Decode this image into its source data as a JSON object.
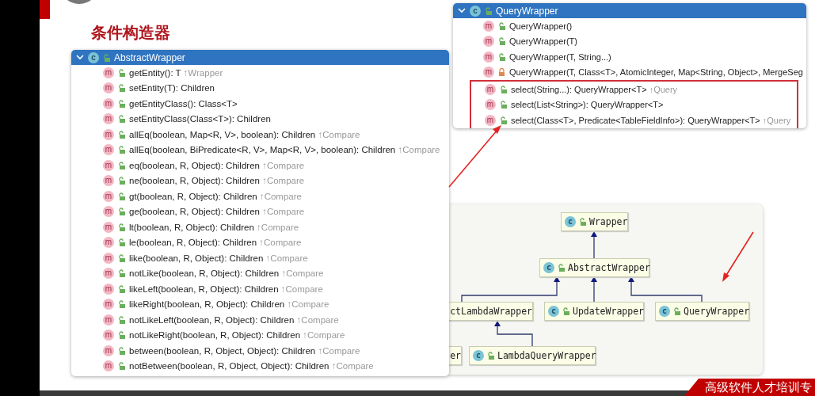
{
  "slide": {
    "title": "条件构造器",
    "footer": "高级软件人才培训专"
  },
  "popups": [
    {
      "header": {
        "label": "AbstractWrapper",
        "badge": "c",
        "expanded": true
      },
      "members": [
        {
          "badge": "m",
          "locked": false,
          "signature": "getEntity(): T",
          "origin": "↑Wrapper",
          "highlighted": false
        },
        {
          "badge": "m",
          "locked": false,
          "signature": "setEntity(T): Children",
          "highlighted": false
        },
        {
          "badge": "m",
          "locked": false,
          "signature": "getEntityClass(): Class<T>",
          "highlighted": false
        },
        {
          "badge": "m",
          "locked": false,
          "signature": "setEntityClass(Class<T>): Children",
          "highlighted": false
        },
        {
          "badge": "m",
          "locked": false,
          "signature": "allEq(boolean, Map<R, V>, boolean): Children",
          "origin": "↑Compare",
          "highlighted": false
        },
        {
          "badge": "m",
          "locked": false,
          "signature": "allEq(boolean, BiPredicate<R, V>, Map<R, V>, boolean): Children",
          "origin": "↑Compare",
          "highlighted": false
        },
        {
          "badge": "m",
          "locked": false,
          "signature": "eq(boolean, R, Object): Children",
          "origin": "↑Compare",
          "highlighted": false
        },
        {
          "badge": "m",
          "locked": false,
          "signature": "ne(boolean, R, Object): Children",
          "origin": "↑Compare",
          "highlighted": false
        },
        {
          "badge": "m",
          "locked": false,
          "signature": "gt(boolean, R, Object): Children",
          "origin": "↑Compare",
          "highlighted": false
        },
        {
          "badge": "m",
          "locked": false,
          "signature": "ge(boolean, R, Object): Children",
          "origin": "↑Compare",
          "highlighted": false
        },
        {
          "badge": "m",
          "locked": false,
          "signature": "lt(boolean, R, Object): Children",
          "origin": "↑Compare",
          "highlighted": false
        },
        {
          "badge": "m",
          "locked": false,
          "signature": "le(boolean, R, Object): Children",
          "origin": "↑Compare",
          "highlighted": false
        },
        {
          "badge": "m",
          "locked": false,
          "signature": "like(boolean, R, Object): Children",
          "origin": "↑Compare",
          "highlighted": false
        },
        {
          "badge": "m",
          "locked": false,
          "signature": "notLike(boolean, R, Object): Children",
          "origin": "↑Compare",
          "highlighted": false
        },
        {
          "badge": "m",
          "locked": false,
          "signature": "likeLeft(boolean, R, Object): Children",
          "origin": "↑Compare",
          "highlighted": false
        },
        {
          "badge": "m",
          "locked": false,
          "signature": "likeRight(boolean, R, Object): Children",
          "origin": "↑Compare",
          "highlighted": false
        },
        {
          "badge": "m",
          "locked": false,
          "signature": "notLikeLeft(boolean, R, Object): Children",
          "origin": "↑Compare",
          "highlighted": false
        },
        {
          "badge": "m",
          "locked": false,
          "signature": "notLikeRight(boolean, R, Object): Children",
          "origin": "↑Compare",
          "highlighted": false
        },
        {
          "badge": "m",
          "locked": false,
          "signature": "between(boolean, R, Object, Object): Children",
          "origin": "↑Compare",
          "highlighted": false
        },
        {
          "badge": "m",
          "locked": false,
          "signature": "notBetween(boolean, R, Object, Object): Children",
          "origin": "↑Compare",
          "highlighted": false
        }
      ]
    },
    {
      "header": {
        "label": "QueryWrapper",
        "badge": "c",
        "expanded": true
      },
      "members": [
        {
          "badge": "m",
          "locked": false,
          "signature": "QueryWrapper()",
          "highlighted": false
        },
        {
          "badge": "m",
          "locked": false,
          "signature": "QueryWrapper(T)",
          "highlighted": false
        },
        {
          "badge": "m",
          "locked": false,
          "signature": "QueryWrapper(T, String...)",
          "highlighted": false
        },
        {
          "badge": "m",
          "locked": true,
          "signature": "QueryWrapper(T, Class<T>, AtomicInteger, Map<String, Object>, MergeSeg",
          "highlighted": false
        },
        {
          "badge": "m",
          "locked": false,
          "signature": "select(String...): QueryWrapper<T>",
          "origin": "↑Query",
          "highlighted": true
        },
        {
          "badge": "m",
          "locked": false,
          "signature": "select(List<String>): QueryWrapper<T>",
          "highlighted": true
        },
        {
          "badge": "m",
          "locked": false,
          "signature": "select(Class<T>, Predicate<TableFieldInfo>): QueryWrapper<T>",
          "origin": "↑Query",
          "highlighted": true
        }
      ]
    }
  ],
  "diagram": {
    "nodes": [
      {
        "label": "Wrapper",
        "badge": "c"
      },
      {
        "label": "AbstractWrapper",
        "badge": "c"
      },
      {
        "label": "ctLambdaWrapper"
      },
      {
        "label": "UpdateWrapper",
        "badge": "c"
      },
      {
        "label": "QueryWrapper",
        "badge": "c"
      },
      {
        "label": "er"
      },
      {
        "label": "LambdaQueryWrapper",
        "badge": "c"
      }
    ]
  }
}
